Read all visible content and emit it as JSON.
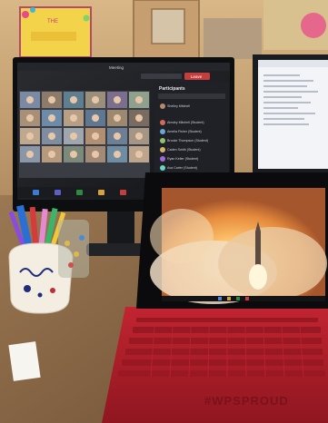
{
  "scene": {
    "classroom_sign": "THE",
    "laptop_keyboard_text": "#WPSPROUD",
    "monitor_meeting_title": "Meeting",
    "participants_panel_title": "Participants",
    "participants": [
      "Shelley Mitchell",
      "Ainsley Mitchell (Student)",
      "Amelia Fisher (Student)",
      "Brooke Thompson (Student)",
      "Caden Smith (Student)",
      "Ryan Keller (Student)",
      "Ava Carter (Student)"
    ],
    "leave_button": "Leave",
    "colors": {
      "wall": "#c9a97a",
      "desk": "#8a6a4a",
      "surface_red": "#b01e2a",
      "screen_dark": "#1f2024",
      "fire": "#f0a04a",
      "smoke": "#e8d2ba"
    }
  }
}
